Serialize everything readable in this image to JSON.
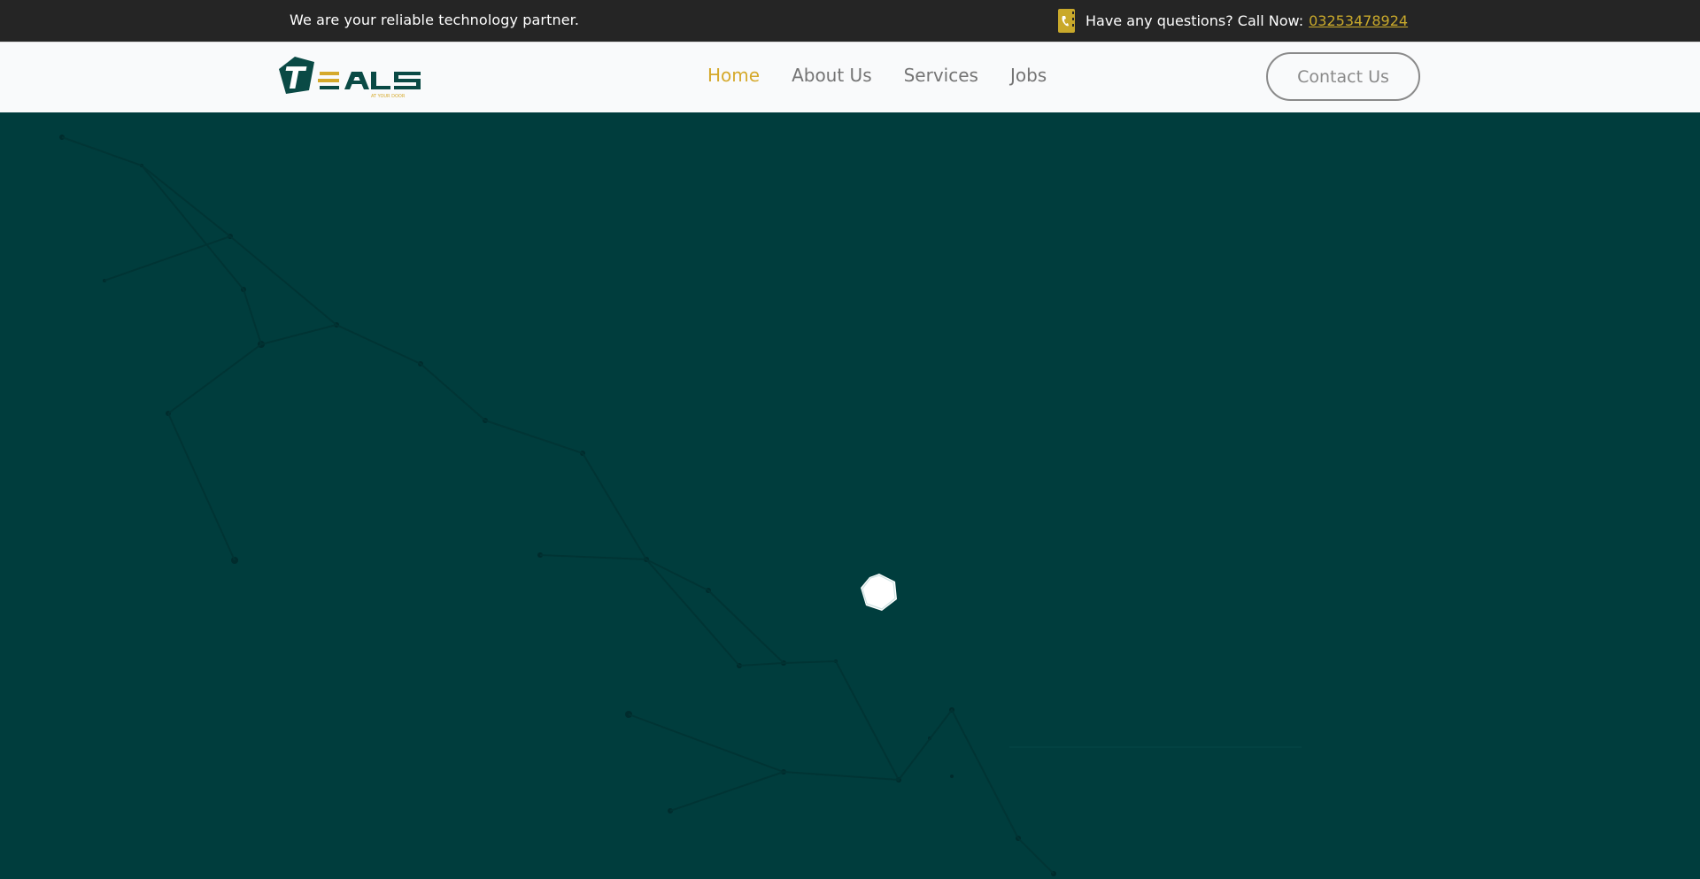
{
  "topbar": {
    "tagline": "We are your reliable technology partner.",
    "question_text": "Have any questions? Call Now:",
    "phone": "03253478924",
    "phone_icon": "phone-icon"
  },
  "logo": {
    "text": "TEALS",
    "subtext": "AT YOUR DOOR"
  },
  "nav": {
    "items": [
      {
        "label": "Home",
        "active": true
      },
      {
        "label": "About Us",
        "active": false
      },
      {
        "label": "Services",
        "active": false
      },
      {
        "label": "Jobs",
        "active": false
      }
    ],
    "cta_label": "Contact Us"
  },
  "hero": {
    "loader_icon": "loading-spinner-icon"
  },
  "colors": {
    "topbar_bg": "#252525",
    "nav_bg": "#f9fafb",
    "accent": "#d5a92b",
    "hero_bg": "#003d3d"
  }
}
